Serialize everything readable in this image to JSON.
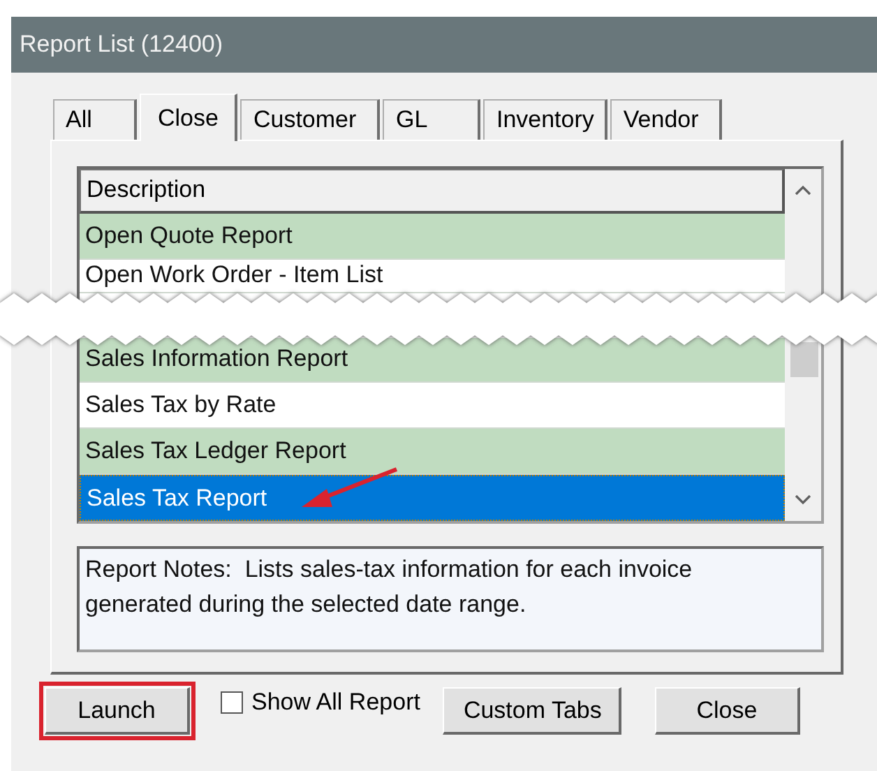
{
  "window": {
    "title": "Report List (12400)"
  },
  "tabs": [
    {
      "label": "All",
      "selected": false
    },
    {
      "label": "Close",
      "selected": true
    },
    {
      "label": "Customer",
      "selected": false
    },
    {
      "label": "GL",
      "selected": false
    },
    {
      "label": "Inventory",
      "selected": false
    },
    {
      "label": "Vendor",
      "selected": false
    }
  ],
  "list": {
    "column": "Description",
    "rows_before_break": [
      {
        "label": "Open Quote Report",
        "selected": false
      },
      {
        "label": "Open Work Order - Item List",
        "selected": false
      }
    ],
    "rows_after_break": [
      {
        "label": "Sales Information Report",
        "selected": false
      },
      {
        "label": "Sales Tax by Rate",
        "selected": false
      },
      {
        "label": "Sales Tax Ledger Report",
        "selected": false
      },
      {
        "label": "Sales Tax Report",
        "selected": true
      }
    ]
  },
  "notes": "Report Notes:  Lists sales-tax information for each invoice generated during the selected date range.",
  "buttons": [
    {
      "kind": "button",
      "label": "Launch",
      "highlighted": true
    },
    {
      "kind": "checkbox",
      "label": "Show All Report",
      "checked": false
    },
    {
      "kind": "button",
      "label": "Custom Tabs",
      "highlighted": false
    },
    {
      "kind": "button",
      "label": "Close",
      "highlighted": false
    }
  ]
}
